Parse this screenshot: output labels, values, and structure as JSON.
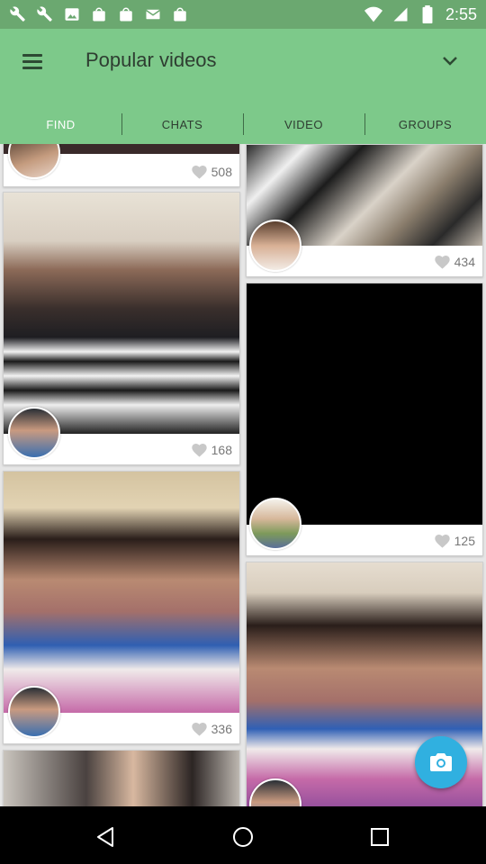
{
  "status_bar": {
    "time": "2:55",
    "left_icons": [
      "wrench-icon",
      "wrench-icon",
      "image-icon",
      "bag-icon",
      "bag-icon",
      "mail-icon",
      "bag-icon"
    ],
    "right_icons": [
      "wifi-icon",
      "signal-icon",
      "battery-icon"
    ]
  },
  "header": {
    "title": "Popular videos",
    "menu_icon": "hamburger-menu-icon",
    "dropdown_icon": "chevron-down-icon",
    "tabs": [
      {
        "label": "FIND",
        "active": true
      },
      {
        "label": "CHATS",
        "active": false
      },
      {
        "label": "VIDEO",
        "active": false
      },
      {
        "label": "GROUPS",
        "active": false
      }
    ]
  },
  "feed": {
    "left_column": [
      {
        "likes": "508"
      },
      {
        "likes": "168"
      },
      {
        "likes": "336"
      },
      {
        "likes": ""
      }
    ],
    "right_column": [
      {
        "likes": "434"
      },
      {
        "likes": "125"
      },
      {
        "likes": ""
      }
    ]
  },
  "fab": {
    "icon": "camera-icon"
  },
  "nav_bar": {
    "icons": [
      "back-icon",
      "home-icon",
      "recents-icon"
    ]
  },
  "colors": {
    "status_bar": "#6ba870",
    "app_bar": "#7dc98a",
    "fab": "#30b0e0",
    "feed_background": "#e6e6e6"
  }
}
